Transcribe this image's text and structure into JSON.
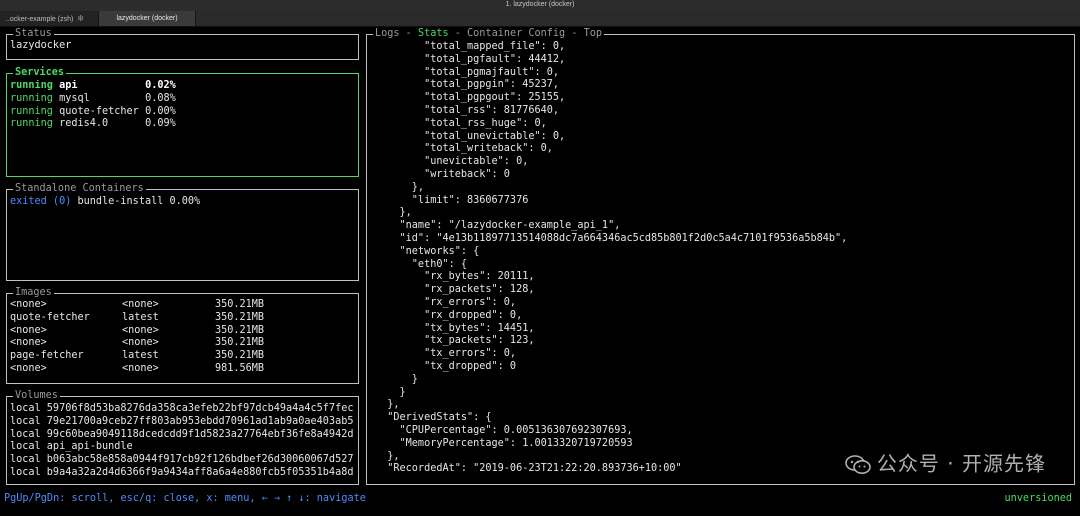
{
  "window": {
    "title": "1. lazydocker (docker)"
  },
  "tabs": [
    {
      "label": "..ocker-example (zsh)"
    },
    {
      "label": "lazydocker (docker)"
    }
  ],
  "status": {
    "title": "Status",
    "value": "lazydocker"
  },
  "services": {
    "title": "Services",
    "items": [
      {
        "state": "running",
        "name": "api",
        "cpu": "0.02%"
      },
      {
        "state": "running",
        "name": "mysql",
        "cpu": "0.08%"
      },
      {
        "state": "running",
        "name": "quote-fetcher",
        "cpu": "0.00%"
      },
      {
        "state": "running",
        "name": "redis4.0",
        "cpu": "0.09%"
      }
    ]
  },
  "standalone": {
    "title": "Standalone Containers",
    "items": [
      {
        "state": "exited (0)",
        "name": "bundle-install",
        "cpu": "0.00%"
      }
    ]
  },
  "images": {
    "title": "Images",
    "items": [
      {
        "name": "<none>",
        "tag": "<none>",
        "size": "350.21MB"
      },
      {
        "name": "quote-fetcher",
        "tag": "latest",
        "size": "350.21MB"
      },
      {
        "name": "<none>",
        "tag": "<none>",
        "size": "350.21MB"
      },
      {
        "name": "<none>",
        "tag": "<none>",
        "size": "350.21MB"
      },
      {
        "name": "page-fetcher",
        "tag": "latest",
        "size": "350.21MB"
      },
      {
        "name": "<none>",
        "tag": "<none>",
        "size": "981.56MB"
      }
    ]
  },
  "volumes": {
    "title": "Volumes",
    "items": [
      "local 59706f8d53ba8276da358ca3efeb22bf97dcb49a4a4c5f7fec",
      "local 79e21700a9ceb27ff803ab953ebdd70961ad1ab9a0ae403ab5",
      "local 99c60bea9049118dcedcdd9f1d5823a27764ebf36fe8a4942d",
      "local api_api-bundle",
      "local b063abc58e858a0944f917cb92f126bdbef26d30060067d527",
      "local b9a4a32a2d4d6366f9a9434aff8a6a4e880fcb5f05351b4a8d"
    ]
  },
  "main": {
    "tabs": [
      {
        "label": "Logs",
        "active": false
      },
      {
        "label": "Stats",
        "active": true
      },
      {
        "label": "Container Config",
        "active": false
      },
      {
        "label": "Top",
        "active": false
      }
    ],
    "separator": " - ",
    "lines": [
      "        \"total_mapped_file\": 0,",
      "        \"total_pgfault\": 44412,",
      "        \"total_pgmajfault\": 0,",
      "        \"total_pgpgin\": 45237,",
      "        \"total_pgpgout\": 25155,",
      "        \"total_rss\": 81776640,",
      "        \"total_rss_huge\": 0,",
      "        \"total_unevictable\": 0,",
      "        \"total_writeback\": 0,",
      "        \"unevictable\": 0,",
      "        \"writeback\": 0",
      "      },",
      "      \"limit\": 8360677376",
      "    },",
      "    \"name\": \"/lazydocker-example_api_1\",",
      "    \"id\": \"4e13b11897713514088dc7a664346ac5cd85b801f2d0c5a4c7101f9536a5b84b\",",
      "    \"networks\": {",
      "      \"eth0\": {",
      "        \"rx_bytes\": 20111,",
      "        \"rx_packets\": 128,",
      "        \"rx_errors\": 0,",
      "        \"rx_dropped\": 0,",
      "        \"tx_bytes\": 14451,",
      "        \"tx_packets\": 123,",
      "        \"tx_errors\": 0,",
      "        \"tx_dropped\": 0",
      "      }",
      "    }",
      "  },",
      "  \"DerivedStats\": {",
      "    \"CPUPercentage\": 0.005136307692307693,",
      "    \"MemoryPercentage\": 1.0013320719720593",
      "  },",
      "  \"RecordedAt\": \"2019-06-23T21:22:20.893736+10:00\""
    ]
  },
  "footer": {
    "keys": "PgUp/PgDn: scroll, esc/q: close, x: menu, ← → ↑ ↓: navigate",
    "version": "unversioned"
  },
  "watermark": {
    "text": "公众号 · 开源先锋",
    "icon": "wechat-icon"
  },
  "colors": {
    "accent": "#4cd964",
    "link": "#4a8cff",
    "background": "#000000"
  }
}
